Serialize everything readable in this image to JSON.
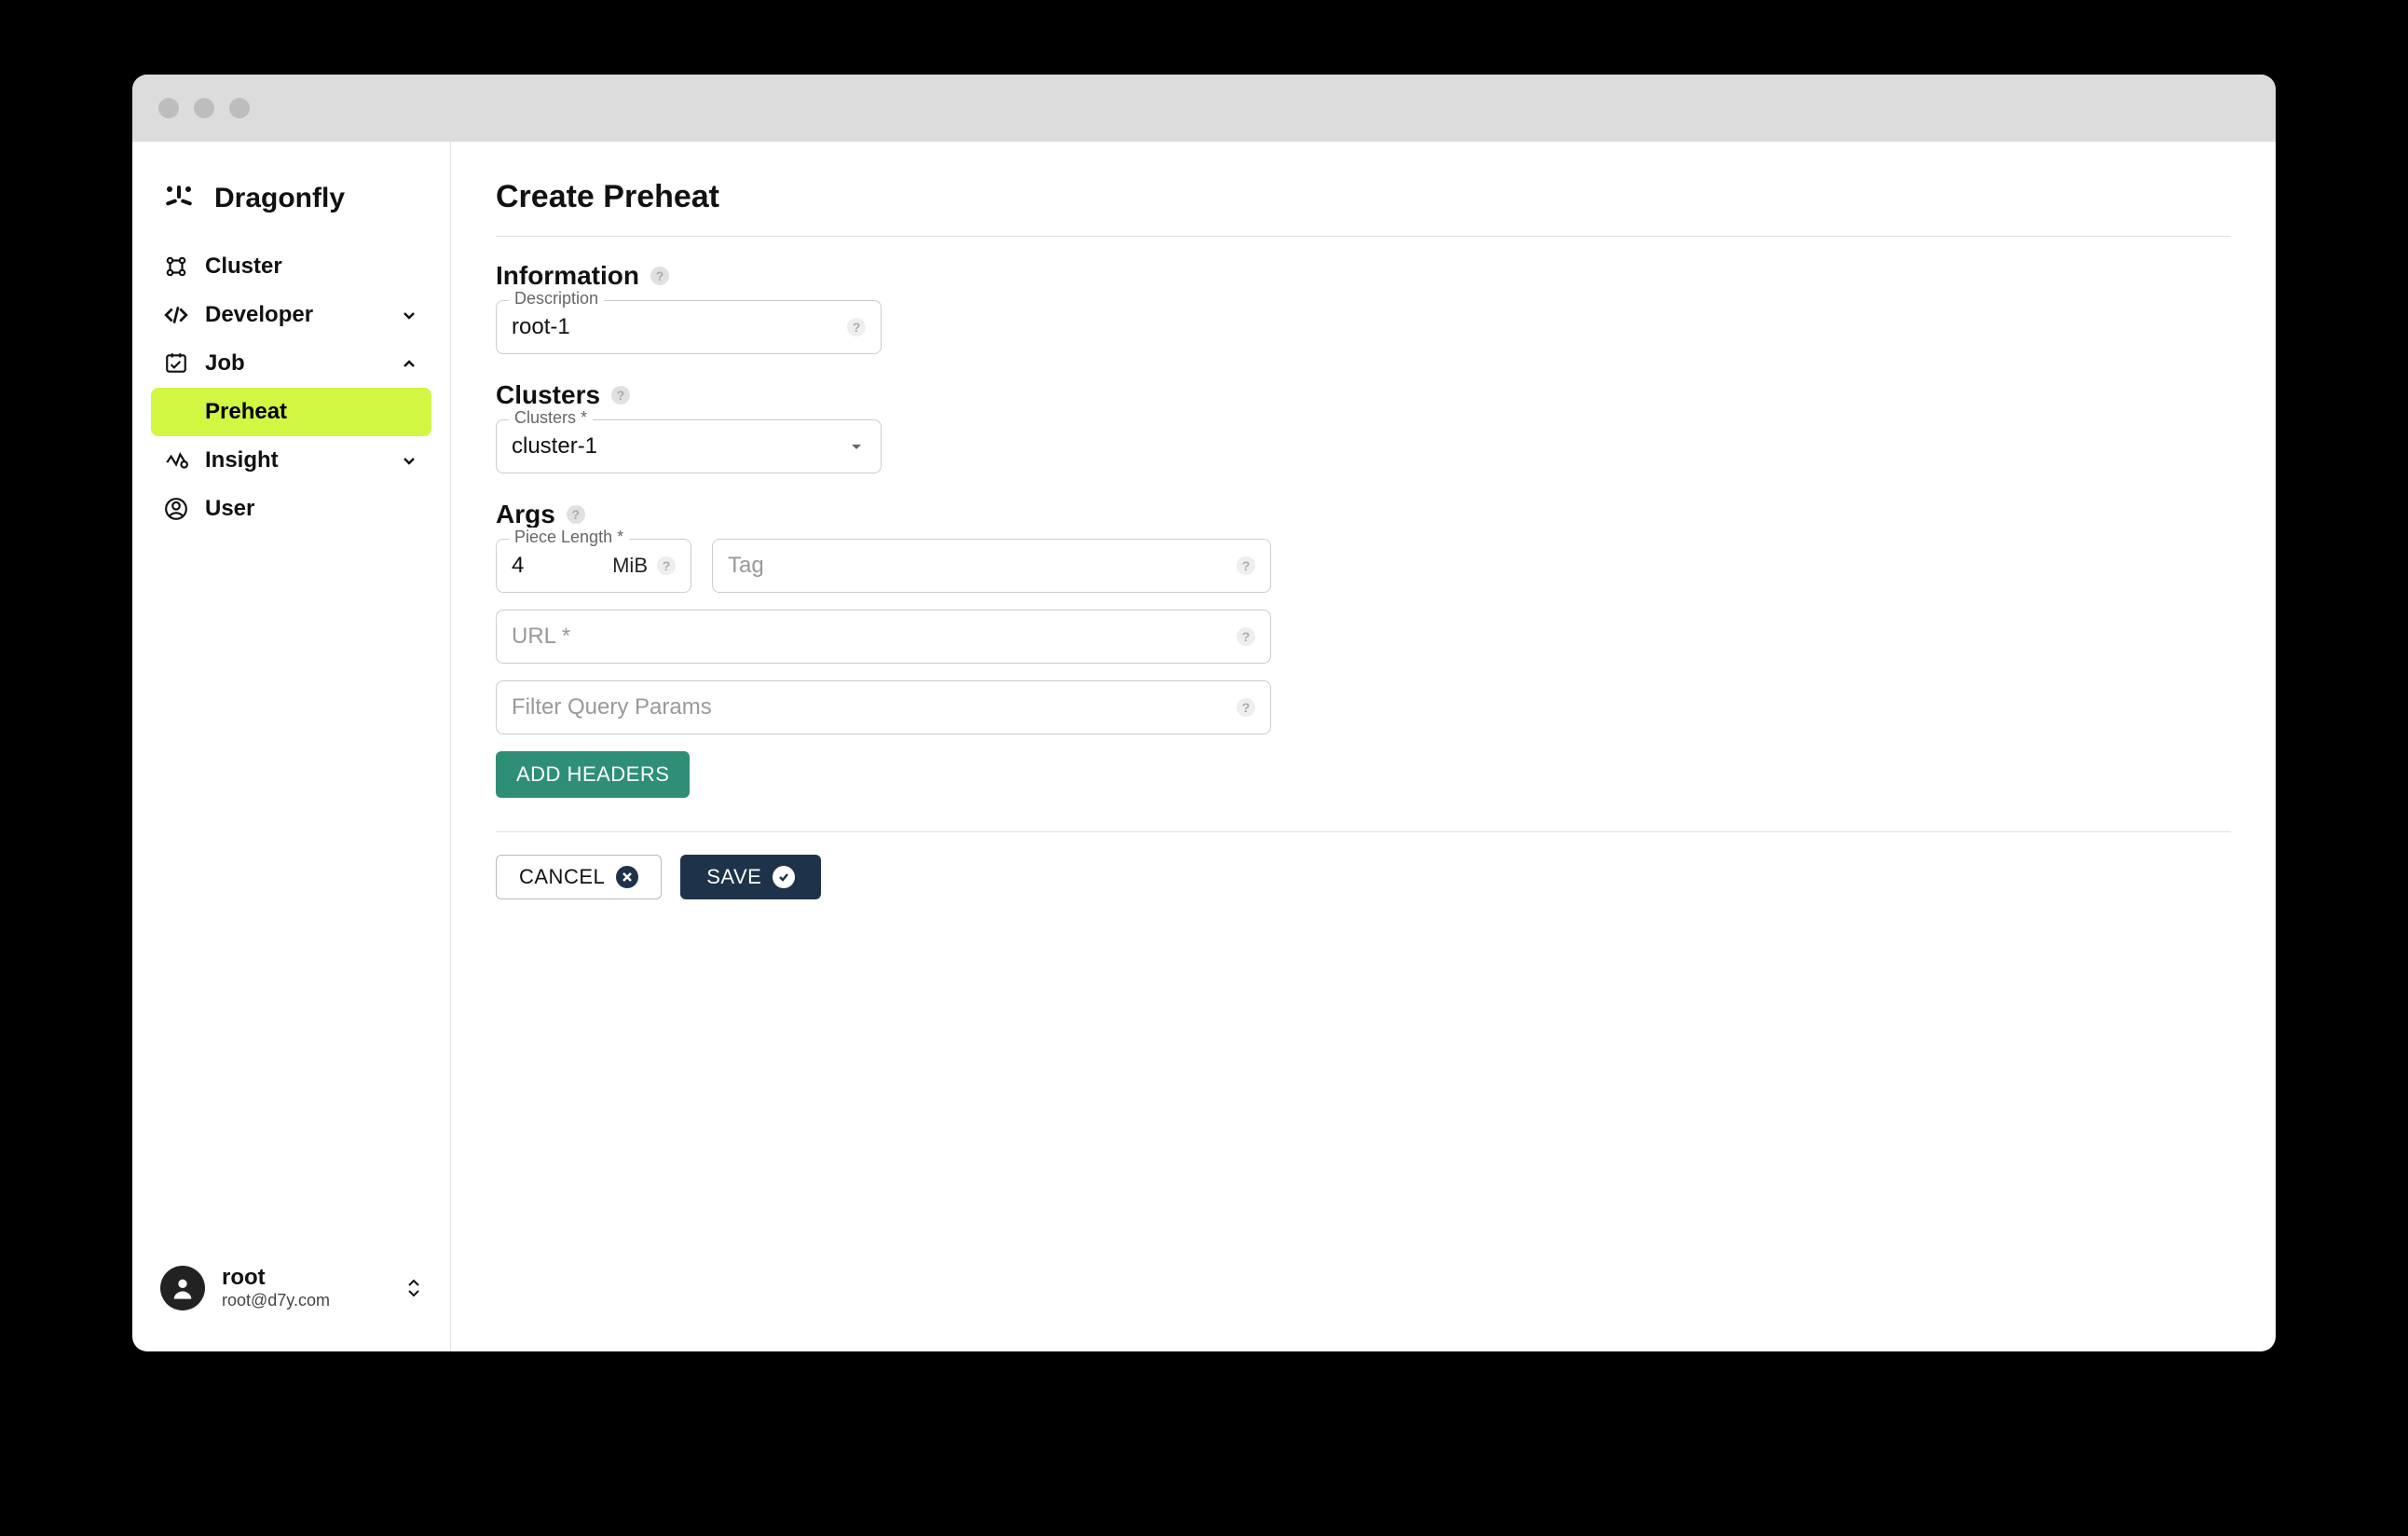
{
  "brand": {
    "name": "Dragonfly"
  },
  "sidebar": {
    "items": [
      {
        "label": "Cluster"
      },
      {
        "label": "Developer"
      },
      {
        "label": "Job"
      },
      {
        "label": "Insight"
      },
      {
        "label": "User"
      }
    ],
    "job_sub": {
      "preheat": "Preheat"
    }
  },
  "user": {
    "name": "root",
    "email": "root@d7y.com"
  },
  "page": {
    "title": "Create Preheat"
  },
  "sections": {
    "information": {
      "heading": "Information",
      "description_label": "Description",
      "description_value": "root-1"
    },
    "clusters": {
      "heading": "Clusters",
      "clusters_label": "Clusters *",
      "clusters_value": "cluster-1"
    },
    "args": {
      "heading": "Args",
      "piece_length_label": "Piece Length *",
      "piece_length_value": "4",
      "piece_length_unit": "MiB",
      "tag_placeholder": "Tag",
      "url_placeholder": "URL *",
      "filter_placeholder": "Filter Query Params",
      "add_headers_label": "ADD HEADERS"
    }
  },
  "actions": {
    "cancel": "CANCEL",
    "save": "SAVE"
  }
}
